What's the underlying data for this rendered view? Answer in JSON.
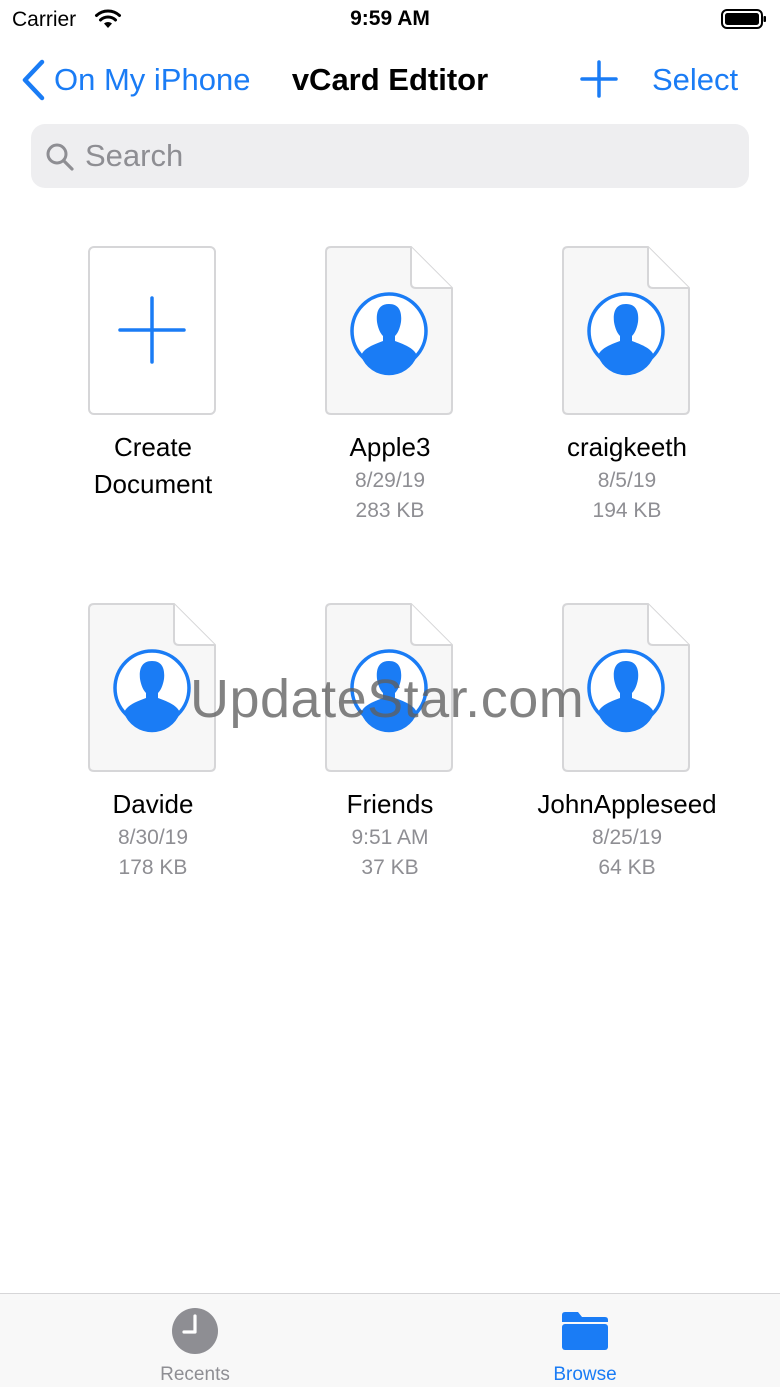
{
  "status_bar": {
    "carrier": "Carrier",
    "time": "9:59 AM"
  },
  "nav": {
    "back_label": "On My iPhone",
    "title": "vCard Edtitor",
    "select_label": "Select"
  },
  "search": {
    "placeholder": "Search"
  },
  "create_tile": {
    "line1": "Create",
    "line2": "Document"
  },
  "files": [
    {
      "name": "Apple3",
      "date": "8/29/19",
      "size": "283 KB"
    },
    {
      "name": "craigkeeth",
      "date": "8/5/19",
      "size": "194 KB"
    },
    {
      "name": "Davide",
      "date": "8/30/19",
      "size": "178 KB"
    },
    {
      "name": "Friends",
      "date": "9:51 AM",
      "size": "37 KB"
    },
    {
      "name": "JohnAppleseed",
      "date": "8/25/19",
      "size": "64 KB"
    }
  ],
  "watermark": "UpdateStar.com",
  "tabs": [
    {
      "label": "Recents",
      "icon": "clock-icon",
      "active": false
    },
    {
      "label": "Browse",
      "icon": "folder-icon",
      "active": true
    }
  ],
  "colors": {
    "accent": "#1a7cf5",
    "inactive": "#8e8e93",
    "search_bg": "#eeeef0"
  }
}
